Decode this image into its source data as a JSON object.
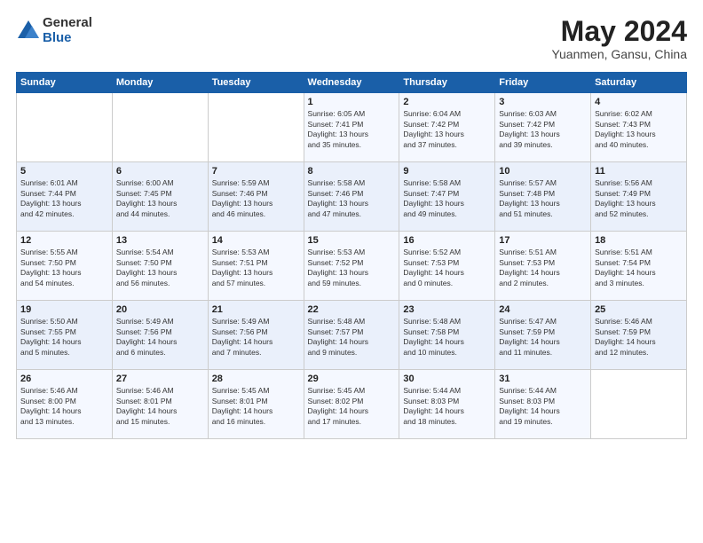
{
  "header": {
    "logo_general": "General",
    "logo_blue": "Blue",
    "title": "May 2024",
    "subtitle": "Yuanmen, Gansu, China"
  },
  "days_of_week": [
    "Sunday",
    "Monday",
    "Tuesday",
    "Wednesday",
    "Thursday",
    "Friday",
    "Saturday"
  ],
  "weeks": [
    [
      {
        "day": "",
        "info": ""
      },
      {
        "day": "",
        "info": ""
      },
      {
        "day": "",
        "info": ""
      },
      {
        "day": "1",
        "info": "Sunrise: 6:05 AM\nSunset: 7:41 PM\nDaylight: 13 hours\nand 35 minutes."
      },
      {
        "day": "2",
        "info": "Sunrise: 6:04 AM\nSunset: 7:42 PM\nDaylight: 13 hours\nand 37 minutes."
      },
      {
        "day": "3",
        "info": "Sunrise: 6:03 AM\nSunset: 7:42 PM\nDaylight: 13 hours\nand 39 minutes."
      },
      {
        "day": "4",
        "info": "Sunrise: 6:02 AM\nSunset: 7:43 PM\nDaylight: 13 hours\nand 40 minutes."
      }
    ],
    [
      {
        "day": "5",
        "info": "Sunrise: 6:01 AM\nSunset: 7:44 PM\nDaylight: 13 hours\nand 42 minutes."
      },
      {
        "day": "6",
        "info": "Sunrise: 6:00 AM\nSunset: 7:45 PM\nDaylight: 13 hours\nand 44 minutes."
      },
      {
        "day": "7",
        "info": "Sunrise: 5:59 AM\nSunset: 7:46 PM\nDaylight: 13 hours\nand 46 minutes."
      },
      {
        "day": "8",
        "info": "Sunrise: 5:58 AM\nSunset: 7:46 PM\nDaylight: 13 hours\nand 47 minutes."
      },
      {
        "day": "9",
        "info": "Sunrise: 5:58 AM\nSunset: 7:47 PM\nDaylight: 13 hours\nand 49 minutes."
      },
      {
        "day": "10",
        "info": "Sunrise: 5:57 AM\nSunset: 7:48 PM\nDaylight: 13 hours\nand 51 minutes."
      },
      {
        "day": "11",
        "info": "Sunrise: 5:56 AM\nSunset: 7:49 PM\nDaylight: 13 hours\nand 52 minutes."
      }
    ],
    [
      {
        "day": "12",
        "info": "Sunrise: 5:55 AM\nSunset: 7:50 PM\nDaylight: 13 hours\nand 54 minutes."
      },
      {
        "day": "13",
        "info": "Sunrise: 5:54 AM\nSunset: 7:50 PM\nDaylight: 13 hours\nand 56 minutes."
      },
      {
        "day": "14",
        "info": "Sunrise: 5:53 AM\nSunset: 7:51 PM\nDaylight: 13 hours\nand 57 minutes."
      },
      {
        "day": "15",
        "info": "Sunrise: 5:53 AM\nSunset: 7:52 PM\nDaylight: 13 hours\nand 59 minutes."
      },
      {
        "day": "16",
        "info": "Sunrise: 5:52 AM\nSunset: 7:53 PM\nDaylight: 14 hours\nand 0 minutes."
      },
      {
        "day": "17",
        "info": "Sunrise: 5:51 AM\nSunset: 7:53 PM\nDaylight: 14 hours\nand 2 minutes."
      },
      {
        "day": "18",
        "info": "Sunrise: 5:51 AM\nSunset: 7:54 PM\nDaylight: 14 hours\nand 3 minutes."
      }
    ],
    [
      {
        "day": "19",
        "info": "Sunrise: 5:50 AM\nSunset: 7:55 PM\nDaylight: 14 hours\nand 5 minutes."
      },
      {
        "day": "20",
        "info": "Sunrise: 5:49 AM\nSunset: 7:56 PM\nDaylight: 14 hours\nand 6 minutes."
      },
      {
        "day": "21",
        "info": "Sunrise: 5:49 AM\nSunset: 7:56 PM\nDaylight: 14 hours\nand 7 minutes."
      },
      {
        "day": "22",
        "info": "Sunrise: 5:48 AM\nSunset: 7:57 PM\nDaylight: 14 hours\nand 9 minutes."
      },
      {
        "day": "23",
        "info": "Sunrise: 5:48 AM\nSunset: 7:58 PM\nDaylight: 14 hours\nand 10 minutes."
      },
      {
        "day": "24",
        "info": "Sunrise: 5:47 AM\nSunset: 7:59 PM\nDaylight: 14 hours\nand 11 minutes."
      },
      {
        "day": "25",
        "info": "Sunrise: 5:46 AM\nSunset: 7:59 PM\nDaylight: 14 hours\nand 12 minutes."
      }
    ],
    [
      {
        "day": "26",
        "info": "Sunrise: 5:46 AM\nSunset: 8:00 PM\nDaylight: 14 hours\nand 13 minutes."
      },
      {
        "day": "27",
        "info": "Sunrise: 5:46 AM\nSunset: 8:01 PM\nDaylight: 14 hours\nand 15 minutes."
      },
      {
        "day": "28",
        "info": "Sunrise: 5:45 AM\nSunset: 8:01 PM\nDaylight: 14 hours\nand 16 minutes."
      },
      {
        "day": "29",
        "info": "Sunrise: 5:45 AM\nSunset: 8:02 PM\nDaylight: 14 hours\nand 17 minutes."
      },
      {
        "day": "30",
        "info": "Sunrise: 5:44 AM\nSunset: 8:03 PM\nDaylight: 14 hours\nand 18 minutes."
      },
      {
        "day": "31",
        "info": "Sunrise: 5:44 AM\nSunset: 8:03 PM\nDaylight: 14 hours\nand 19 minutes."
      },
      {
        "day": "",
        "info": ""
      }
    ]
  ]
}
